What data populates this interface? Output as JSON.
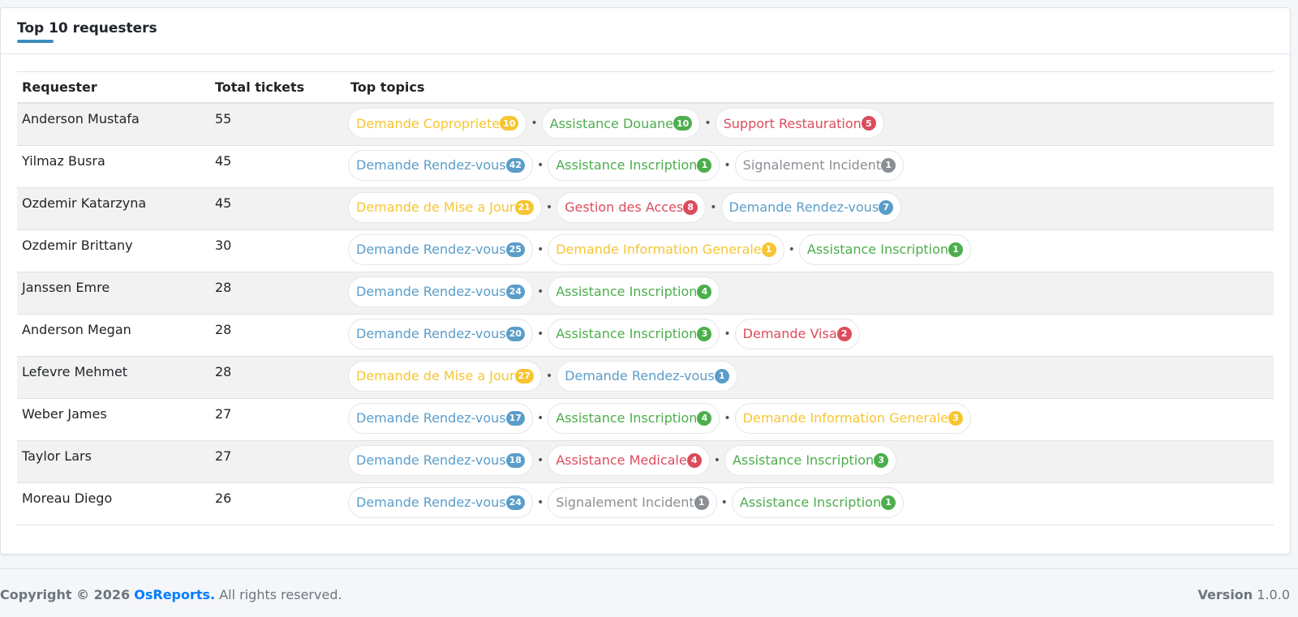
{
  "card": {
    "title": "Top 10 requesters",
    "columns": {
      "requester": "Requester",
      "total": "Total tickets",
      "topics": "Top topics"
    }
  },
  "colors": {
    "blue": "#5b9dc9",
    "green": "#4cae4c",
    "red": "#dc4c5c",
    "yellow": "#f7c532",
    "gray": "#8a8f94"
  },
  "rows": [
    {
      "name": "Anderson Mustafa",
      "total": "55",
      "topics": [
        {
          "label": "Demande Copropriete",
          "count": "10",
          "color": "yellow"
        },
        {
          "label": "Assistance Douane",
          "count": "10",
          "color": "green"
        },
        {
          "label": "Support Restauration",
          "count": "5",
          "color": "red"
        }
      ]
    },
    {
      "name": "Yilmaz Busra",
      "total": "45",
      "topics": [
        {
          "label": "Demande Rendez-vous",
          "count": "42",
          "color": "blue"
        },
        {
          "label": "Assistance Inscription",
          "count": "1",
          "color": "green"
        },
        {
          "label": "Signalement Incident",
          "count": "1",
          "color": "gray"
        }
      ]
    },
    {
      "name": "Ozdemir Katarzyna",
      "total": "45",
      "topics": [
        {
          "label": "Demande de Mise a Jour",
          "count": "21",
          "color": "yellow"
        },
        {
          "label": "Gestion des Acces",
          "count": "8",
          "color": "red"
        },
        {
          "label": "Demande Rendez-vous",
          "count": "7",
          "color": "blue"
        }
      ]
    },
    {
      "name": "Ozdemir Brittany",
      "total": "30",
      "topics": [
        {
          "label": "Demande Rendez-vous",
          "count": "25",
          "color": "blue"
        },
        {
          "label": "Demande Information Generale",
          "count": "1",
          "color": "yellow"
        },
        {
          "label": "Assistance Inscription",
          "count": "1",
          "color": "green"
        }
      ]
    },
    {
      "name": "Janssen Emre",
      "total": "28",
      "topics": [
        {
          "label": "Demande Rendez-vous",
          "count": "24",
          "color": "blue"
        },
        {
          "label": "Assistance Inscription",
          "count": "4",
          "color": "green"
        }
      ]
    },
    {
      "name": "Anderson Megan",
      "total": "28",
      "topics": [
        {
          "label": "Demande Rendez-vous",
          "count": "20",
          "color": "blue"
        },
        {
          "label": "Assistance Inscription",
          "count": "3",
          "color": "green"
        },
        {
          "label": "Demande Visa",
          "count": "2",
          "color": "red"
        }
      ]
    },
    {
      "name": "Lefevre Mehmet",
      "total": "28",
      "topics": [
        {
          "label": "Demande de Mise a Jour",
          "count": "27",
          "color": "yellow"
        },
        {
          "label": "Demande Rendez-vous",
          "count": "1",
          "color": "blue"
        }
      ]
    },
    {
      "name": "Weber James",
      "total": "27",
      "topics": [
        {
          "label": "Demande Rendez-vous",
          "count": "17",
          "color": "blue"
        },
        {
          "label": "Assistance Inscription",
          "count": "4",
          "color": "green"
        },
        {
          "label": "Demande Information Generale",
          "count": "3",
          "color": "yellow"
        }
      ]
    },
    {
      "name": "Taylor Lars",
      "total": "27",
      "topics": [
        {
          "label": "Demande Rendez-vous",
          "count": "18",
          "color": "blue"
        },
        {
          "label": "Assistance Medicale",
          "count": "4",
          "color": "red"
        },
        {
          "label": "Assistance Inscription",
          "count": "3",
          "color": "green"
        }
      ]
    },
    {
      "name": "Moreau Diego",
      "total": "26",
      "topics": [
        {
          "label": "Demande Rendez-vous",
          "count": "24",
          "color": "blue"
        },
        {
          "label": "Signalement Incident",
          "count": "1",
          "color": "gray"
        },
        {
          "label": "Assistance Inscription",
          "count": "1",
          "color": "green"
        }
      ]
    }
  ],
  "separator": "•",
  "footer": {
    "copyright": "Copyright © 2026",
    "brand": "OsReports.",
    "rights": "All rights reserved.",
    "version_label": "Version",
    "version": "1.0.0"
  }
}
